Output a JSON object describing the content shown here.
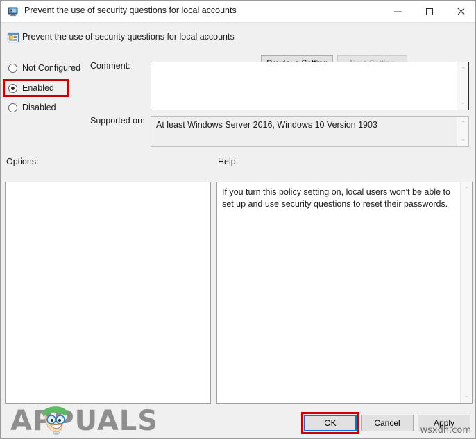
{
  "window": {
    "title": "Prevent the use of security questions for local accounts",
    "title_icon": "computer-policy-icon",
    "minimize_label": "—",
    "maximize_label": "□",
    "close_label": "✕"
  },
  "header": {
    "icon": "policy-setting-icon",
    "title": "Prevent the use of security questions for local accounts",
    "previous_setting_label": "Previous Setting",
    "next_setting_label": "Next Setting",
    "next_setting_disabled": true
  },
  "state_options": {
    "selected": "Enabled",
    "items": [
      {
        "label": "Not Configured",
        "checked": false
      },
      {
        "label": "Enabled",
        "checked": true
      },
      {
        "label": "Disabled",
        "checked": false
      }
    ]
  },
  "comment": {
    "label": "Comment:",
    "value": "",
    "scroll_up": "⌃",
    "scroll_down": "⌄"
  },
  "supported_on": {
    "label": "Supported on:",
    "value": "At least Windows Server 2016, Windows 10 Version 1903",
    "scroll_up": "⌃",
    "scroll_down": "⌄"
  },
  "options": {
    "label": "Options:",
    "value": ""
  },
  "help": {
    "label": "Help:",
    "text": "If you turn this policy setting on, local users won't be able to set up and use security questions to reset their passwords.",
    "scroll_up": "⌃",
    "scroll_down": "⌄"
  },
  "footer": {
    "ok_label": "OK",
    "cancel_label": "Cancel",
    "apply_label": "Apply"
  },
  "watermarks": {
    "brand": "APPUALS",
    "corner": "wsxdn.com"
  },
  "colors": {
    "annotation_red": "#cc0000",
    "focus_blue": "#0078d7",
    "dialog_bg": "#f0f0f0",
    "brand_gray": "#8e8e8e"
  }
}
